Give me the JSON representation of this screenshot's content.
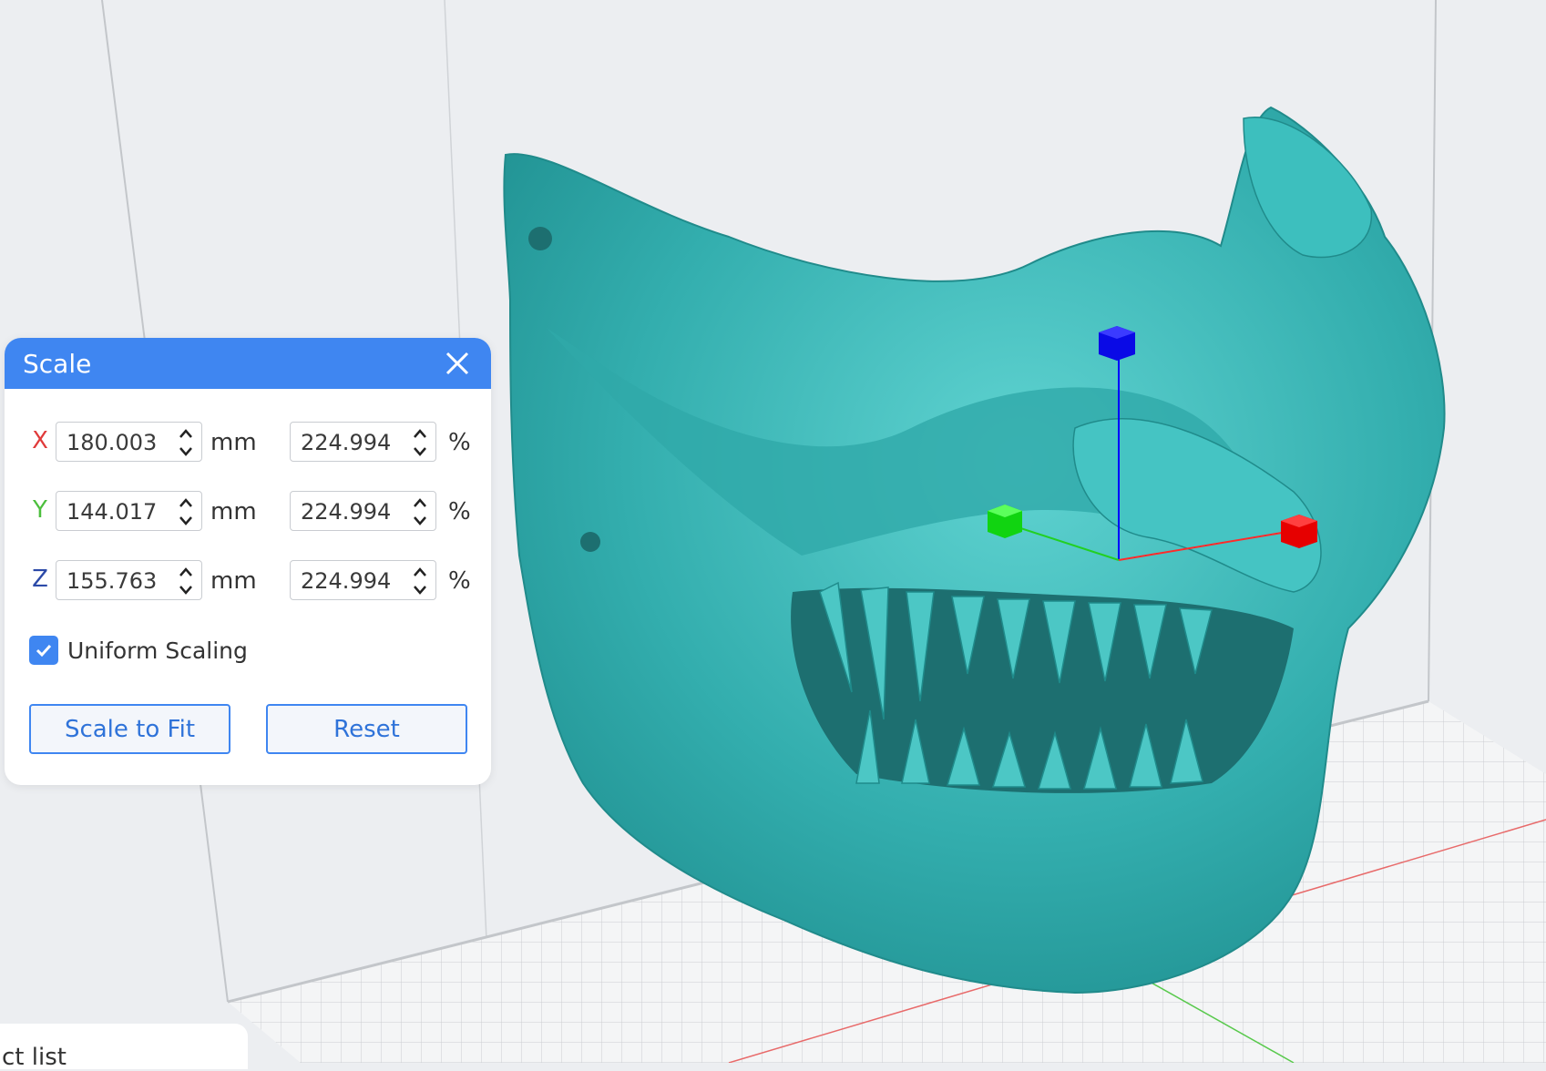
{
  "viewport": {
    "model_color": "#3ab5b5",
    "gizmo": {
      "x_color": "#ff0000",
      "y_color": "#00e000",
      "z_color": "#0000ff"
    }
  },
  "scale_dialog": {
    "title": "Scale",
    "accent_color": "#3f86f1",
    "rows": [
      {
        "axis": "X",
        "axis_color": "#e03b3b",
        "size": "180.003",
        "size_unit": "mm",
        "percent": "224.994",
        "percent_unit": "%"
      },
      {
        "axis": "Y",
        "axis_color": "#4cbf3d",
        "size": "144.017",
        "size_unit": "mm",
        "percent": "224.994",
        "percent_unit": "%"
      },
      {
        "axis": "Z",
        "axis_color": "#2c4aa8",
        "size": "155.763",
        "size_unit": "mm",
        "percent": "224.994",
        "percent_unit": "%"
      }
    ],
    "uniform_scaling": {
      "label": "Uniform Scaling",
      "checked": true
    },
    "scale_to_fit_label": "Scale to Fit",
    "reset_label": "Reset"
  },
  "object_list_tab": {
    "label": "ct list"
  }
}
